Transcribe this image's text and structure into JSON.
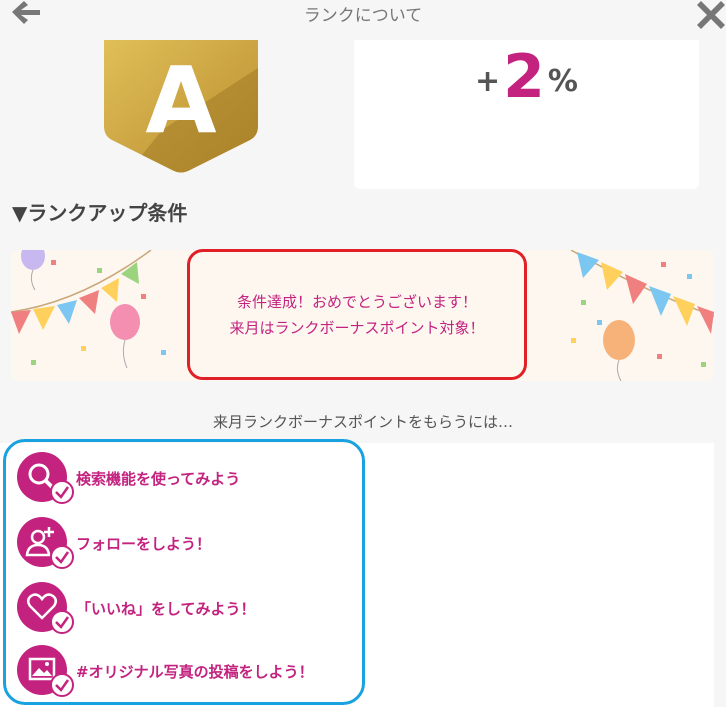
{
  "header": {
    "title": "ランクについて",
    "back_icon": "arrow-left-icon",
    "close_icon": "close-icon"
  },
  "rank": {
    "letter": "A",
    "badge_color": "#c9a03c"
  },
  "bonus": {
    "sign": "+",
    "value": "2",
    "unit": "%"
  },
  "conditions": {
    "title": "▼ランクアップ条件"
  },
  "celebration": {
    "line1": "条件達成！おめでとうございます！",
    "line2": "来月はランクボーナスポイント対象！"
  },
  "howto": {
    "text": "来月ランクボーナスポイントをもらうには…"
  },
  "tasks": [
    {
      "label": "検索機能を使ってみよう",
      "icon": "search-icon",
      "done": true
    },
    {
      "label": "フォローをしよう！",
      "icon": "user-plus-icon",
      "done": true
    },
    {
      "label": "「いいね」をしてみよう！",
      "icon": "heart-icon",
      "done": true
    },
    {
      "label": "#オリジナル写真の投稿をしよう！",
      "icon": "image-icon",
      "done": true
    }
  ],
  "colors": {
    "accent": "#c3237f",
    "highlight_red": "#e01f26",
    "highlight_blue": "#1aa1e0",
    "gold": "#c9a03c"
  }
}
